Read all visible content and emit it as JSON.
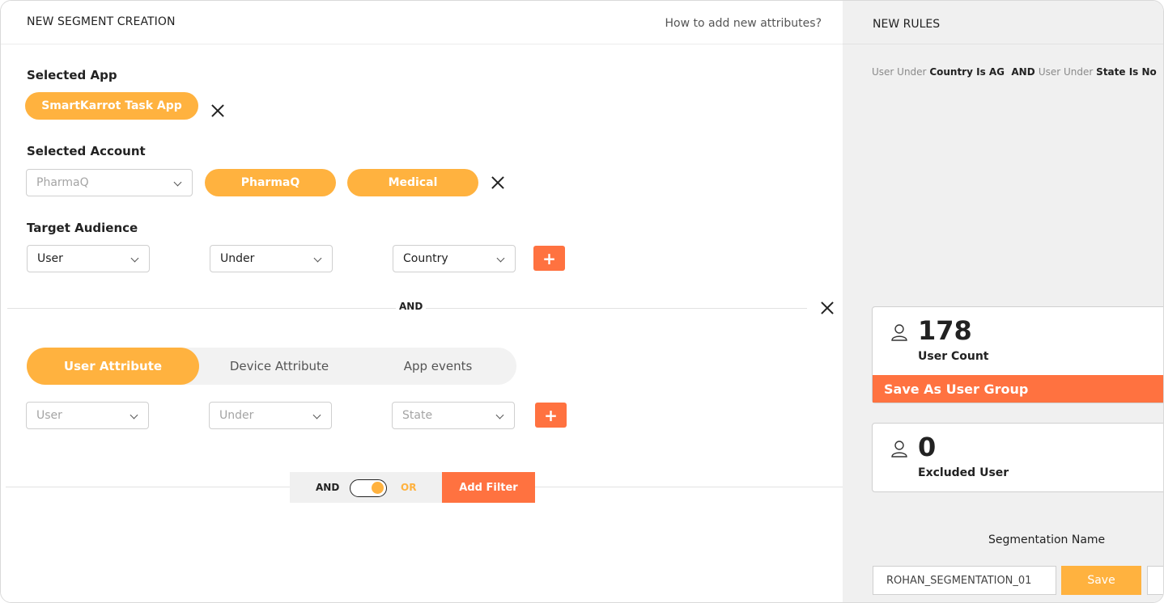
{
  "header": {
    "title": "NEW SEGMENT CREATION",
    "help_link": "How to add new attributes?"
  },
  "selected_app": {
    "label": "Selected App",
    "value": "SmartKarrot Task App"
  },
  "selected_account": {
    "label": "Selected  Account",
    "dropdown_value": "PharmaQ",
    "tags": [
      "PharmaQ",
      "Medical"
    ]
  },
  "target_audience": {
    "label": "Target Audience",
    "row1": [
      "User",
      "Under",
      "Country"
    ],
    "plus": "+"
  },
  "divider": {
    "label": "AND"
  },
  "tabs": [
    "User Attribute",
    "Device Attribute",
    "App events"
  ],
  "row2": {
    "placeholders": [
      "User",
      "Under",
      "State"
    ],
    "plus": "+"
  },
  "bottom_bar": {
    "and_label": "AND",
    "or_label": "OR",
    "toggle_state": "OR",
    "add_filter": "Add Filter"
  },
  "right_panel": {
    "title": "NEW RULES",
    "rule": {
      "p1": "User Under ",
      "b1": "Country Is AG",
      "mid": "  AND ",
      "p2": "User Under ",
      "b2": "State Is No"
    },
    "user_count": {
      "value": "178",
      "label": "User Count",
      "action": "Save As User Group"
    },
    "excluded": {
      "value": "0",
      "label": "Excluded User"
    },
    "segmentation": {
      "label": "Segmentation Name",
      "value": "ROHAN_SEGMENTATION_01",
      "save": "Save"
    }
  },
  "colors": {
    "accent_yellow": "#ffb23f",
    "accent_orange": "#ff7240",
    "panel_bg": "#f0f0f0"
  },
  "icons": [
    "close-icon",
    "chevron-down-icon",
    "plus-icon",
    "user-icon"
  ]
}
